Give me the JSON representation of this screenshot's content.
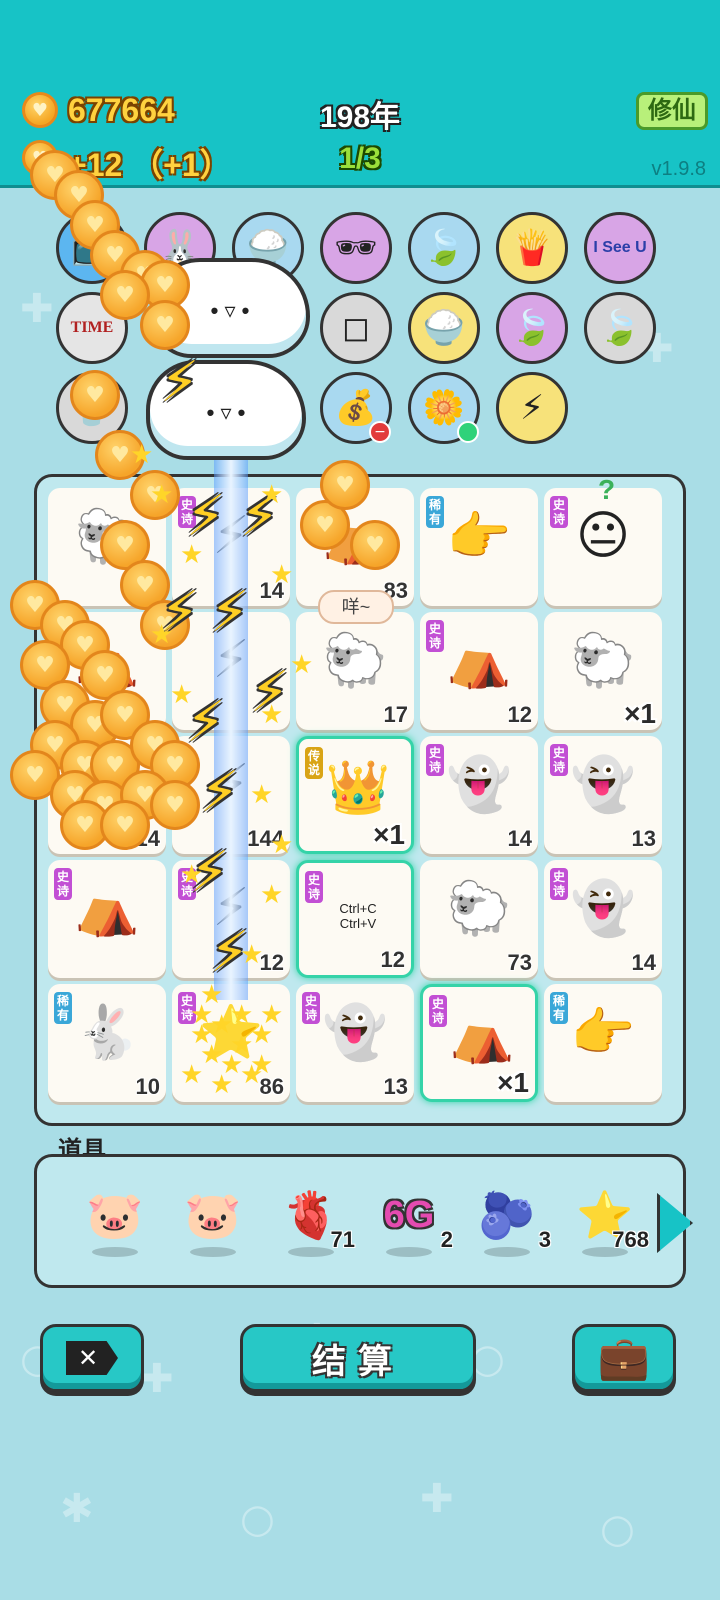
{
  "header": {
    "coin_total": "677664",
    "coin_rate": "+12 （+1）",
    "year": "198年",
    "round": "1/3",
    "xiuxian_label": "修仙",
    "version": "v1.9.8"
  },
  "shop": {
    "items": [
      {
        "icon": "tv-icon",
        "glyph": "📺"
      },
      {
        "icon": "rabbit-icon",
        "glyph": "🐰"
      },
      {
        "icon": "rice-icon",
        "glyph": "🍚"
      },
      {
        "icon": "sunglasses-orange-icon",
        "glyph": "🕶"
      },
      {
        "icon": "leaf-icon",
        "glyph": "🍃"
      },
      {
        "icon": "fries-icon",
        "glyph": "🍟"
      },
      {
        "icon": "i-see-u-icon",
        "glyph": "I See U"
      },
      {
        "icon": "time-magazine-icon",
        "glyph": "TIME"
      },
      {
        "icon": "sugar-cubes-icon",
        "glyph": "◻"
      },
      {
        "icon": "rice-bowl-icon",
        "glyph": "🍚"
      },
      {
        "icon": "leaf-icon",
        "glyph": "🍃"
      },
      {
        "icon": "leaf-icon",
        "glyph": "🍃"
      },
      {
        "icon": "milk-tea-icon",
        "glyph": "🥤"
      },
      {
        "icon": "sack-icon",
        "glyph": "💰"
      },
      {
        "icon": "flower-pot-icon",
        "glyph": "🌼"
      },
      {
        "icon": "lightning-icon",
        "glyph": "⚡"
      }
    ]
  },
  "board": {
    "speech": "咩~",
    "question_mark": "?",
    "tiles": [
      {
        "tag": "",
        "icon": "sheep-icon",
        "glyph": "🐑",
        "count": ""
      },
      {
        "tag": "史诗",
        "tag_type": "epic",
        "icon": "lightning-icon",
        "glyph": "⚡",
        "count": "14"
      },
      {
        "tag": "",
        "icon": "rabbit-tent-icon",
        "glyph": "⛺",
        "count": "83"
      },
      {
        "tag": "稀有",
        "tag_type": "rare",
        "icon": "pointing-hand-icon",
        "glyph": "👉",
        "count": ""
      },
      {
        "tag": "史诗",
        "tag_type": "epic",
        "icon": "face-icon",
        "glyph": "😐",
        "count": ""
      },
      {
        "tag": "",
        "icon": "rabbit-tent-icon",
        "glyph": "⛺",
        "count": ""
      },
      {
        "tag": "",
        "icon": "lightning-icon",
        "glyph": "⚡",
        "count": ""
      },
      {
        "tag": "",
        "icon": "sheep-icon",
        "glyph": "🐑",
        "count": "17"
      },
      {
        "tag": "史诗",
        "tag_type": "epic",
        "icon": "rabbit-tent-icon",
        "glyph": "⛺",
        "count": "12"
      },
      {
        "tag": "",
        "icon": "sheep-icon",
        "glyph": "🐑",
        "count": "×1",
        "mult": true
      },
      {
        "tag": "",
        "icon": "coin-icon",
        "glyph": "",
        "count": "14"
      },
      {
        "tag": "",
        "icon": "lightning-icon",
        "glyph": "⚡",
        "count": "144"
      },
      {
        "tag": "传说",
        "tag_type": "legend",
        "icon": "king-icon",
        "glyph": "👑",
        "count": "×1",
        "mult": true,
        "highlight": true
      },
      {
        "tag": "史诗",
        "tag_type": "epic",
        "icon": "ghost-icon",
        "glyph": "👻",
        "count": "14"
      },
      {
        "tag": "史诗",
        "tag_type": "epic",
        "icon": "ghost-icon",
        "glyph": "👻",
        "count": "13"
      },
      {
        "tag": "史诗",
        "tag_type": "epic",
        "icon": "rabbit-tent-icon",
        "glyph": "⛺",
        "count": ""
      },
      {
        "tag": "史诗",
        "tag_type": "epic",
        "icon": "lightning-icon",
        "glyph": "⚡",
        "count": "12"
      },
      {
        "tag": "史诗",
        "tag_type": "epic",
        "icon": "copy-paste-icon",
        "glyph": "Ctrl+C\nCtrl+V",
        "count": "12",
        "highlight": true
      },
      {
        "tag": "",
        "icon": "sheep-icon",
        "glyph": "🐑",
        "count": "73"
      },
      {
        "tag": "史诗",
        "tag_type": "epic",
        "icon": "ghost-icon",
        "glyph": "👻",
        "count": "14"
      },
      {
        "tag": "稀有",
        "tag_type": "rare",
        "icon": "rabbit-icon",
        "glyph": "🐇",
        "count": "10"
      },
      {
        "tag": "史诗",
        "tag_type": "epic",
        "icon": "star-icon",
        "glyph": "⭐",
        "count": "86"
      },
      {
        "tag": "史诗",
        "tag_type": "epic",
        "icon": "ghost-icon",
        "glyph": "👻",
        "count": "13"
      },
      {
        "tag": "史诗",
        "tag_type": "epic",
        "icon": "rabbit-tent-icon",
        "glyph": "⛺",
        "count": "×1",
        "mult": true,
        "highlight": true
      },
      {
        "tag": "稀有",
        "tag_type": "rare",
        "icon": "pointing-hand-icon",
        "glyph": "👉",
        "count": ""
      }
    ]
  },
  "props": {
    "title": "道具",
    "items": [
      {
        "icon": "piggy-bank-icon",
        "glyph": "🐷",
        "count": ""
      },
      {
        "icon": "piggy-bank-icon",
        "glyph": "🐷",
        "count": ""
      },
      {
        "icon": "liver-icon",
        "glyph": "🫀",
        "count": "71"
      },
      {
        "icon": "6g-icon",
        "glyph": "6G",
        "count": "2"
      },
      {
        "icon": "blueberry-icon",
        "glyph": "🫐",
        "count": "3"
      },
      {
        "icon": "star-icon",
        "glyph": "⭐",
        "count": "768"
      }
    ]
  },
  "buttons": {
    "close_label": "✕",
    "settle_label": "结算",
    "bag_glyph": "💼"
  },
  "colors": {
    "header_bg": "#17c3c6",
    "page_bg": "#a9dde6",
    "epic_tag": "#c24fd4",
    "rare_tag": "#3aa7d8",
    "legend_tag": "#d9a415",
    "coin": "#f5a623"
  }
}
